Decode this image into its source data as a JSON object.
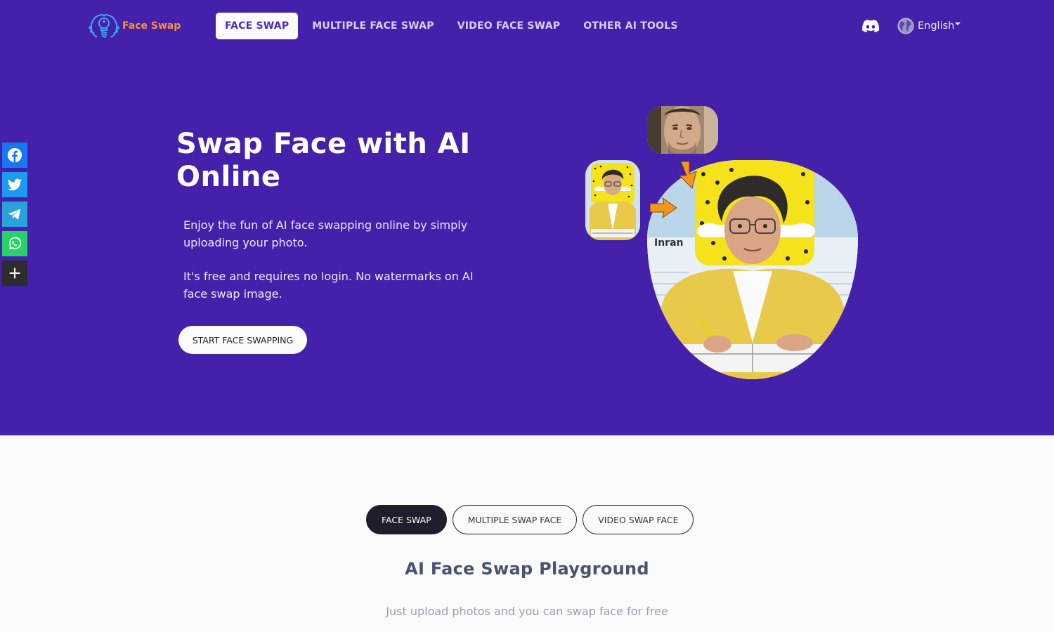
{
  "brand": {
    "name": "Face Swap",
    "logo_icon": "lightbulb-heads-icon",
    "colors": {
      "hero_bg": "#4521ab",
      "logo_text": "#f7923a",
      "active_nav_text": "#4e2bbf",
      "page_bg": "#fafafa",
      "tab_active_bg": "#1e1e2c"
    }
  },
  "nav": {
    "items": [
      {
        "label": "FACE SWAP",
        "active": true
      },
      {
        "label": "MULTIPLE FACE SWAP",
        "active": false
      },
      {
        "label": "VIDEO FACE SWAP",
        "active": false
      },
      {
        "label": "OTHER AI TOOLS",
        "active": false
      }
    ],
    "discord_icon": "discord-icon",
    "language": {
      "icon": "globe-icon",
      "selected": "English"
    }
  },
  "share": {
    "items": [
      {
        "name": "facebook",
        "icon": "facebook-icon"
      },
      {
        "name": "twitter",
        "icon": "twitter-icon"
      },
      {
        "name": "telegram",
        "icon": "telegram-icon"
      },
      {
        "name": "whatsapp",
        "icon": "whatsapp-icon"
      },
      {
        "name": "more",
        "icon": "plus-icon"
      }
    ]
  },
  "hero": {
    "title": "Swap Face with AI Online",
    "paragraph1": "Enjoy the fun of AI face swapping online by simply uploading your photo.",
    "paragraph2": "It's free and requires no login. No watermarks on AI face swap image.",
    "cta": "START FACE SWAPPING",
    "illustration": {
      "source_face_alt": "Source face portrait",
      "target_alt": "Target image of man in yellow shirt",
      "result_alt": "Face swap result",
      "profile_name_in_image": "Inran"
    }
  },
  "playground": {
    "tabs": [
      {
        "label": "FACE SWAP",
        "active": true
      },
      {
        "label": "MULTIPLE SWAP FACE",
        "active": false
      },
      {
        "label": "VIDEO SWAP FACE",
        "active": false
      }
    ],
    "title": "AI Face Swap Playground",
    "subtitle": "Just upload photos and you can swap face for free"
  }
}
